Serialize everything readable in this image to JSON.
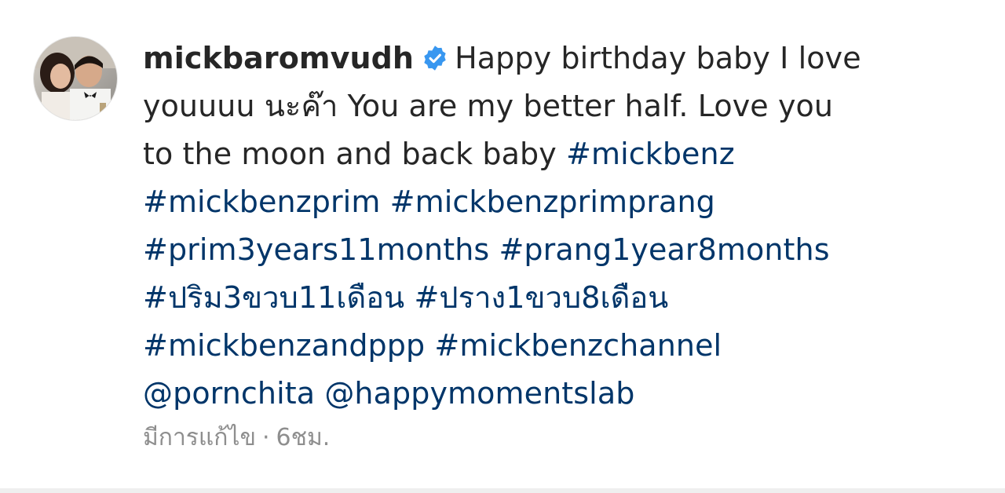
{
  "post": {
    "username": "mickbaromvudh",
    "verified_badge": "verified-badge-icon",
    "caption_lines": [
      "Happy birthday baby I love",
      "youuuu นะค๊า You are my better half. Love you",
      "to the moon and back baby"
    ],
    "hashtags": {
      "mickbenz": "#mickbenz",
      "mickbenzprim": "#mickbenzprim",
      "mickbenzprimprang": "#mickbenzprimprang",
      "prim": "#prim3years11months",
      "prang": "#prang1year8months",
      "prim_thai": "#ปริม3ขวบ11เดือน",
      "prang_thai": "#ปราง1ขวบ8เดือน",
      "andppp": "#mickbenzandppp",
      "channel": "#mickbenzchannel"
    },
    "mentions": {
      "porn": "@pornchita",
      "happy": "@happymomentslab"
    },
    "meta": {
      "edited": "มีการแก้ไข",
      "separator": "·",
      "time": "6ชม."
    }
  },
  "colors": {
    "text": "#262626",
    "link": "#003569",
    "meta": "#8e8e8e",
    "verified": "#3897f0"
  }
}
